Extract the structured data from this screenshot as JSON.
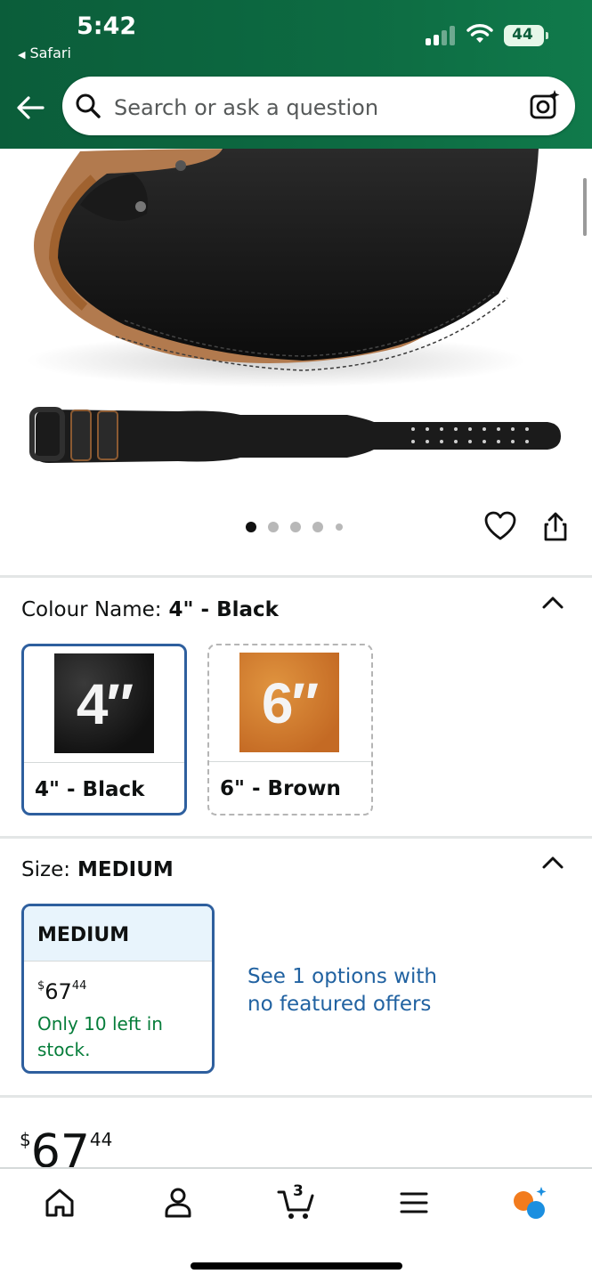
{
  "status_bar": {
    "time": "5:42",
    "back_app": "Safari",
    "battery": "44"
  },
  "search": {
    "placeholder": "Search or ask a question"
  },
  "gallery": {
    "image_count": 5,
    "active_index": 0
  },
  "colour": {
    "label": "Colour Name:",
    "selected": "4\" - Black",
    "options": [
      {
        "caption": "4\" - Black",
        "mark": "4″",
        "selected": true
      },
      {
        "caption": "6\" - Brown",
        "mark": "6″",
        "selected": false
      }
    ]
  },
  "size": {
    "label": "Size:",
    "selected": "MEDIUM",
    "card": {
      "name": "MEDIUM",
      "price_symbol": "$",
      "price_whole": "67",
      "price_fraction": "44",
      "stock": "Only 10 left in stock."
    },
    "options_link": "See 1 options with no featured offers"
  },
  "price": {
    "symbol": "$",
    "whole": "67",
    "fraction": "44"
  },
  "tabbar": {
    "cart_count": "3"
  },
  "colors": {
    "header": "#0d6b42",
    "accent_blue": "#2e5f9e",
    "link": "#2162a1",
    "stock_green": "#067d3a"
  }
}
